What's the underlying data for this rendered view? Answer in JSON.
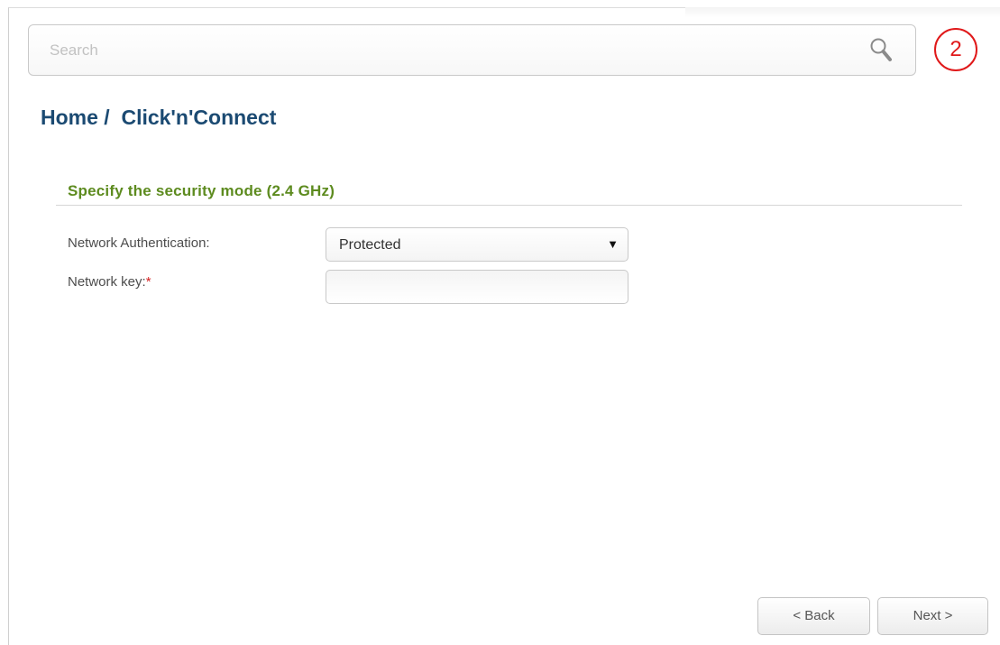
{
  "search": {
    "placeholder": "Search",
    "icon": "search-icon"
  },
  "notifications": {
    "count": "2",
    "color": "#e0191a"
  },
  "breadcrumb": {
    "text": "Home /  Click'n'Connect"
  },
  "section": {
    "title": "Specify the security mode (2.4 GHz)"
  },
  "form": {
    "auth_label": "Network Authentication:",
    "auth_value": "Protected",
    "key_label": "Network key:",
    "key_required": "*",
    "key_value": ""
  },
  "buttons": {
    "back": "< Back",
    "next": "Next >"
  },
  "colors": {
    "breadcrumb": "#1b4a72",
    "section_title": "#5d8b1f",
    "required": "#d32222"
  }
}
